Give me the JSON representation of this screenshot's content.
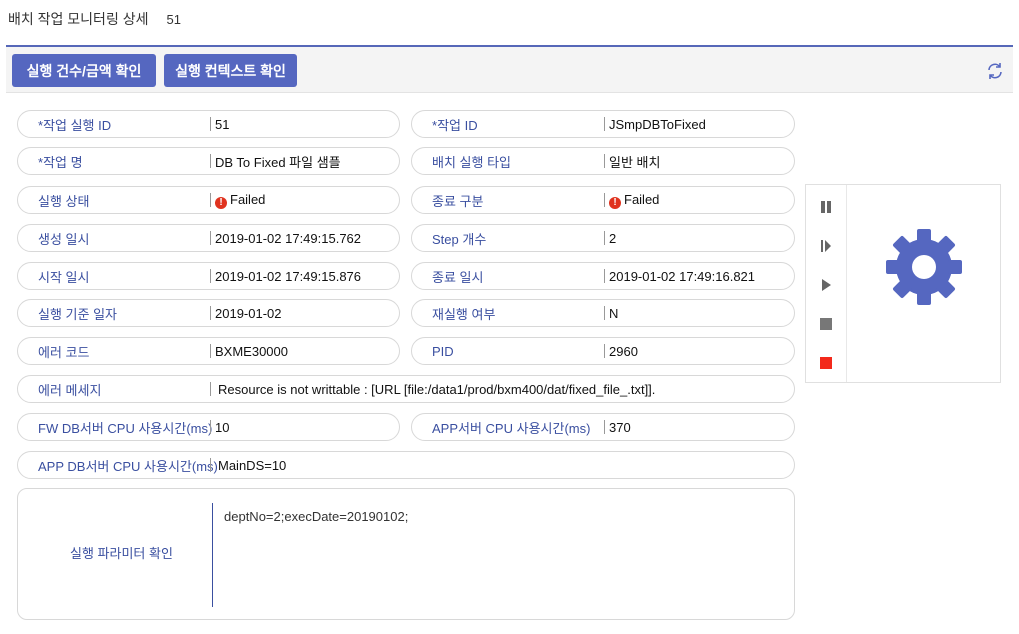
{
  "header": {
    "title": "배치 작업 모니터링 상세",
    "count": "51"
  },
  "toolbar": {
    "btn_count_amount": "실행 건수/금액 확인",
    "btn_context": "실행 컨텍스트 확인"
  },
  "fields": {
    "exec_id": {
      "label": "작업 실행 ID",
      "required": "*",
      "value": "51"
    },
    "job_id": {
      "label": "작업 ID",
      "required": "*",
      "value": "JSmpDBToFixed"
    },
    "job_name": {
      "label": "작업 명",
      "required": "*",
      "value": "DB To Fixed 파일 샘플"
    },
    "batch_type": {
      "label": "배치 실행 타입",
      "value": "일반 배치"
    },
    "exec_status": {
      "label": "실행 상태",
      "value": "Failed"
    },
    "end_type": {
      "label": "종료 구분",
      "value": "Failed"
    },
    "created_at": {
      "label": "생성 일시",
      "value": "2019-01-02 17:49:15.762"
    },
    "step_count": {
      "label": "Step 개수",
      "value": "2"
    },
    "start_at": {
      "label": "시작 일시",
      "value": "2019-01-02 17:49:15.876"
    },
    "end_at": {
      "label": "종료 일시",
      "value": "2019-01-02 17:49:16.821"
    },
    "base_date": {
      "label": "실행 기준 일자",
      "value": "2019-01-02"
    },
    "rerun": {
      "label": "재실행 여부",
      "value": "N"
    },
    "error_code": {
      "label": "에러 코드",
      "value": "BXME30000"
    },
    "pid": {
      "label": "PID",
      "value": "2960"
    },
    "error_msg": {
      "label": "에러 메세지",
      "value": "Resource is not writtable : [URL [file:/data1/prod/bxm400/dat/fixed_file_.txt]]."
    },
    "fw_cpu": {
      "label": "FW DB서버 CPU 사용시간(ms)",
      "value": "10"
    },
    "app_cpu": {
      "label": "APP서버 CPU 사용시간(ms)",
      "value": "370"
    },
    "app_db_cpu": {
      "label": "APP DB서버 CPU 사용시간(ms)",
      "value": "MainDS=10"
    }
  },
  "params": {
    "label": "실행 파라미터 확인",
    "value": "deptNo=2;execDate=20190102;"
  },
  "colors": {
    "accent": "#5567c0",
    "label": "#3a4fa0",
    "error": "#e0331f",
    "gear": "#5567c0",
    "icon_gray": "#666666"
  },
  "icons": [
    "refresh-icon",
    "failed-icon",
    "pause-icon",
    "step-icon",
    "play-icon",
    "stop-icon",
    "kill-icon",
    "gear-icon"
  ]
}
